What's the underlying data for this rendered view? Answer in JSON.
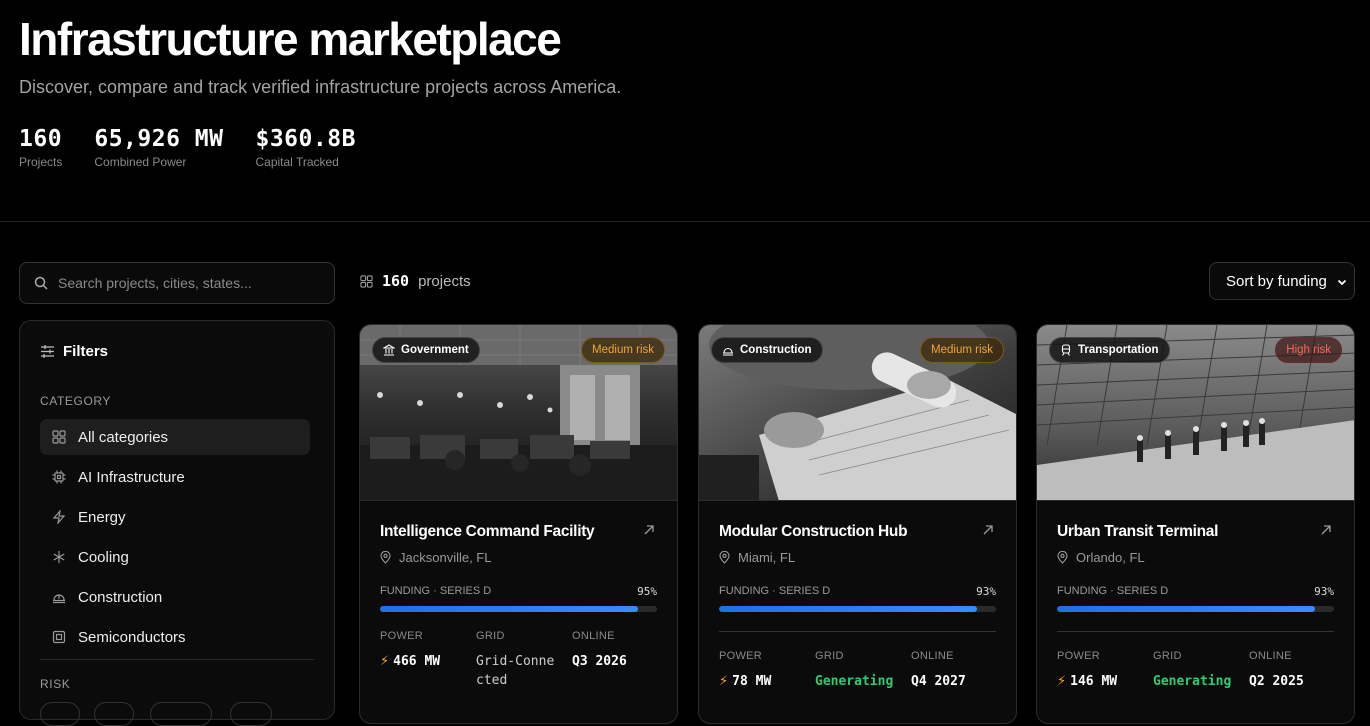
{
  "hero": {
    "title": "Infrastructure marketplace",
    "subtitle": "Discover, compare and track verified infrastructure projects across America.",
    "stats": [
      {
        "value": "160",
        "label": "Projects"
      },
      {
        "value": "65,926 MW",
        "label": "Combined Power"
      },
      {
        "value": "$360.8B",
        "label": "Capital Tracked"
      }
    ]
  },
  "search": {
    "placeholder": "Search projects, cities, states..."
  },
  "filters": {
    "title": "Filters",
    "category_label": "CATEGORY",
    "categories": [
      {
        "label": "All categories",
        "icon": "grid-icon",
        "active": true
      },
      {
        "label": "AI Infrastructure",
        "icon": "chip-icon"
      },
      {
        "label": "Energy",
        "icon": "bolt-icon"
      },
      {
        "label": "Cooling",
        "icon": "snowflake-icon"
      },
      {
        "label": "Construction",
        "icon": "hardhat-icon"
      },
      {
        "label": "Semiconductors",
        "icon": "cpu-icon"
      }
    ],
    "risk_label": "RISK"
  },
  "toolbar": {
    "count": "160",
    "count_label": "projects",
    "sort": "Sort by funding"
  },
  "cards": [
    {
      "category": "Government",
      "risk": "Medium risk",
      "title": "Intelligence Command Facility",
      "location": "Jacksonville, FL",
      "funding_label": "FUNDING · SERIES D",
      "funding_pct": "95%",
      "funding_value": 0.93,
      "power_label": "POWER",
      "power": "466 MW",
      "grid_label": "GRID",
      "grid": "Grid-Connected",
      "online_label": "ONLINE",
      "online": "Q3 2026"
    },
    {
      "category": "Construction",
      "risk": "Medium risk",
      "title": "Modular Construction Hub",
      "location": "Miami, FL",
      "funding_label": "FUNDING · SERIES D",
      "funding_pct": "93%",
      "funding_value": 0.93,
      "power_label": "POWER",
      "power": "78 MW",
      "grid_label": "GRID",
      "grid": "Generating",
      "online_label": "ONLINE",
      "online": "Q4 2027"
    },
    {
      "category": "Transportation",
      "risk": "High risk",
      "title": "Urban Transit Terminal",
      "location": "Orlando, FL",
      "funding_label": "FUNDING · SERIES D",
      "funding_pct": "93%",
      "funding_value": 0.93,
      "power_label": "POWER",
      "power": "146 MW",
      "grid_label": "GRID",
      "grid": "Generating",
      "online_label": "ONLINE",
      "online": "Q2 2025"
    }
  ],
  "colors": {
    "accent_blue": "#1f6fe5",
    "risk_medium": "#f0a53a",
    "risk_high": "#ef6a5a",
    "generating": "#2ecc71",
    "power_bolt": "#f5a623"
  }
}
